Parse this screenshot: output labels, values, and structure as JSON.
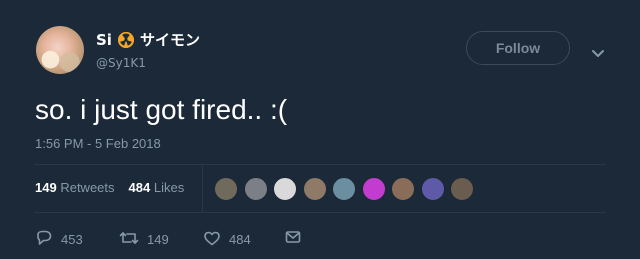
{
  "author": {
    "display_name": "Si",
    "name_suffix": "サイモン",
    "handle": "@Sy1K1",
    "badge_icon": "radioactive-icon"
  },
  "header": {
    "follow_label": "Follow",
    "menu_icon": "chevron-down-icon"
  },
  "tweet": {
    "text": "so. i just got fired.. :(",
    "timestamp": "1:56 PM - 5 Feb 2018"
  },
  "stats": {
    "retweets_count": "149",
    "retweets_label": "Retweets",
    "likes_count": "484",
    "likes_label": "Likes"
  },
  "likers": [
    {
      "name": "liker-avatar-1",
      "color": "#6f6a5b"
    },
    {
      "name": "liker-avatar-2",
      "color": "#7b7f86"
    },
    {
      "name": "liker-avatar-3",
      "color": "#d9d9d9"
    },
    {
      "name": "liker-avatar-4",
      "color": "#8e7a66"
    },
    {
      "name": "liker-avatar-5",
      "color": "#6b8fa0"
    },
    {
      "name": "liker-avatar-6",
      "color": "#c13ccf"
    },
    {
      "name": "liker-avatar-7",
      "color": "#8a6d58"
    },
    {
      "name": "liker-avatar-8",
      "color": "#5e5aa8"
    },
    {
      "name": "liker-avatar-9",
      "color": "#6a5c4f"
    }
  ],
  "actions": {
    "replies_count": "453",
    "retweets_count": "149",
    "likes_count": "484"
  },
  "colors": {
    "background": "#1c2938",
    "muted_text": "#8899a6",
    "badge": "#f5a623"
  }
}
